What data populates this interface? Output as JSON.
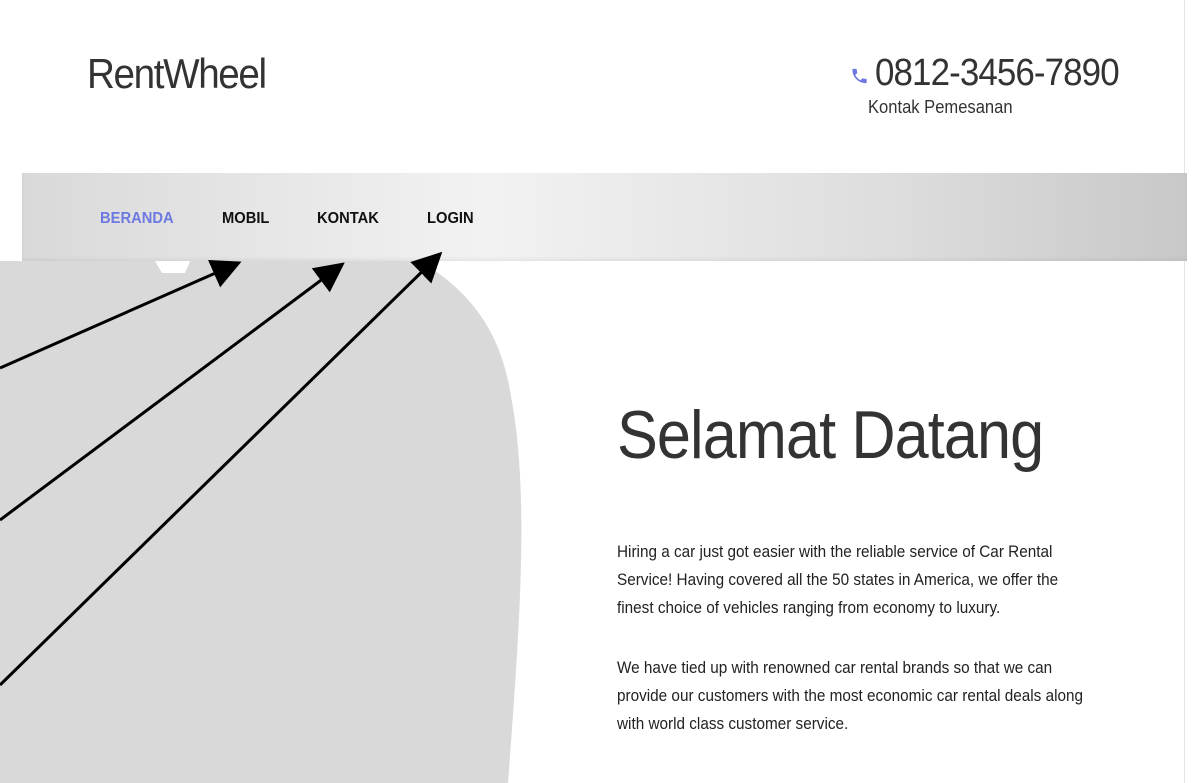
{
  "header": {
    "brand": "RentWheel",
    "phone_number": "0812-3456-7890",
    "contact_label": "Kontak Pemesanan",
    "phone_icon": "phone-icon"
  },
  "nav": {
    "items": [
      {
        "label": "BERANDA",
        "active": true
      },
      {
        "label": "MOBIL",
        "active": false
      },
      {
        "label": "KONTAK",
        "active": false
      },
      {
        "label": "LOGIN",
        "active": false
      }
    ]
  },
  "hero": {
    "title": "Selamat Datang",
    "paragraph_1": "Hiring a car just got easier with the reliable service of Car Rental Service! Having covered all the 50 states in America, we offer the finest choice of vehicles ranging from economy to luxury.",
    "paragraph_2": "We have tied up with renowned car rental brands so that we can provide our customers with the most economic car rental deals along with world class customer service."
  },
  "colors": {
    "accent": "#6d79e0",
    "phone_icon": "#6d79e0",
    "hero_shape": "#d9d9d9",
    "navbar": "#e3e3e3"
  }
}
